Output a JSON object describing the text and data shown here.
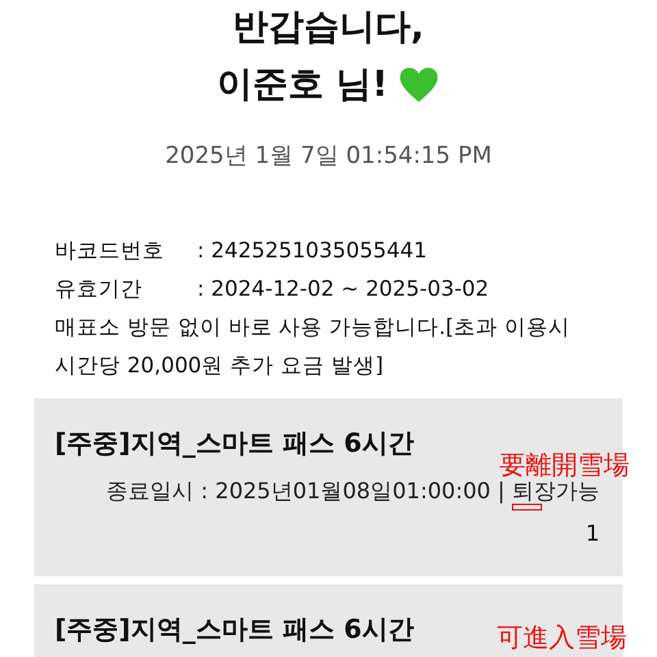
{
  "greeting": {
    "line_1": "반갑습니다,",
    "line_2": "이준호 님!"
  },
  "timestamp": "2025년 1월 7일 01:54:15 PM",
  "info": [
    {
      "label": "바코드번호",
      "value": ": 2425251035055441"
    },
    {
      "label": "유효기간",
      "value": ": 2024-12-02 ~ 2025-03-02"
    }
  ],
  "notice": "매표소 방문 없이 바로 사용 가능합니다.[초과 이용시 시간당 20,000원 추가 요금 발생]",
  "passes": [
    {
      "title": "[주중]지역_스마트 패스 6시간",
      "end_time": "종료일시 : 2025년01월08일01:00:00 | ",
      "status": "퇴장가능",
      "count": "1",
      "annotation": "要離開雪場",
      "marked": true
    },
    {
      "title": "[주중]지역_스마트 패스 6시간",
      "annotation": "可進入雪場",
      "marked": false
    }
  ]
}
